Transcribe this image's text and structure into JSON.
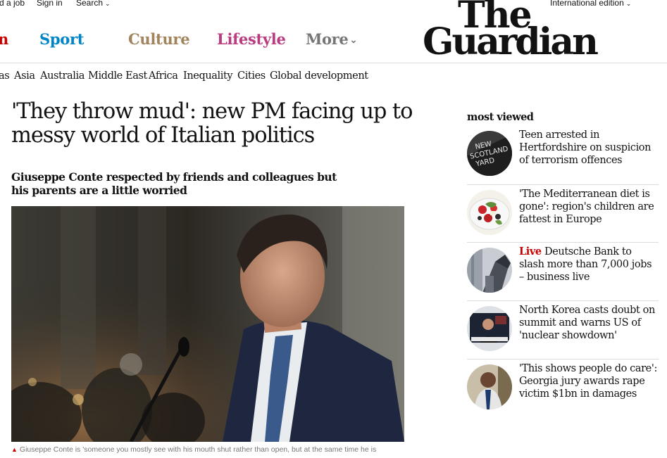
{
  "topbar": {
    "job_link": "d a job",
    "signin_link": "Sign in",
    "search_link": "Search",
    "edition_label": "International edition"
  },
  "pillars": {
    "news": "n",
    "sport": "Sport",
    "culture": "Culture",
    "lifestyle": "Lifestyle",
    "more": "More"
  },
  "logo": {
    "line1": "The",
    "line2": "Guardian"
  },
  "subnav": [
    "as",
    "Asia",
    "Australia",
    "Middle East",
    "Africa",
    "Inequality",
    "Cities",
    "Global development"
  ],
  "article": {
    "headline": "'They throw mud': new PM facing up to messy world of Italian politics",
    "standfirst": "Giuseppe Conte respected by friends and colleagues but his parents are a little worried",
    "caption": "Giuseppe Conte is 'someone you mostly see with his mouth shut rather than open, but at the same time he is"
  },
  "most_viewed": {
    "heading": "most viewed",
    "items": [
      {
        "kicker": "",
        "title": "Teen arrested in Hertfordshire on suspicion of terrorism offences",
        "thumb_text": "NEW\nSCOTLAND\nYARD"
      },
      {
        "kicker": "",
        "title": "'The Mediterranean diet is gone': region's children are fattest in Europe",
        "thumb_text": ""
      },
      {
        "kicker": "Live",
        "title": "Deutsche Bank to slash more than 7,000 jobs – business live",
        "thumb_text": ""
      },
      {
        "kicker": "",
        "title": "North Korea casts doubt on summit and warns US of 'nuclear showdown'",
        "thumb_text": ""
      },
      {
        "kicker": "",
        "title": "'This shows people do care': Georgia jury awards rape victim $1bn in damages",
        "thumb_text": ""
      }
    ]
  },
  "colors": {
    "news": "#c70000",
    "sport": "#0084c6",
    "culture": "#a1845c",
    "lifestyle": "#bb3b80",
    "more": "#767676"
  }
}
